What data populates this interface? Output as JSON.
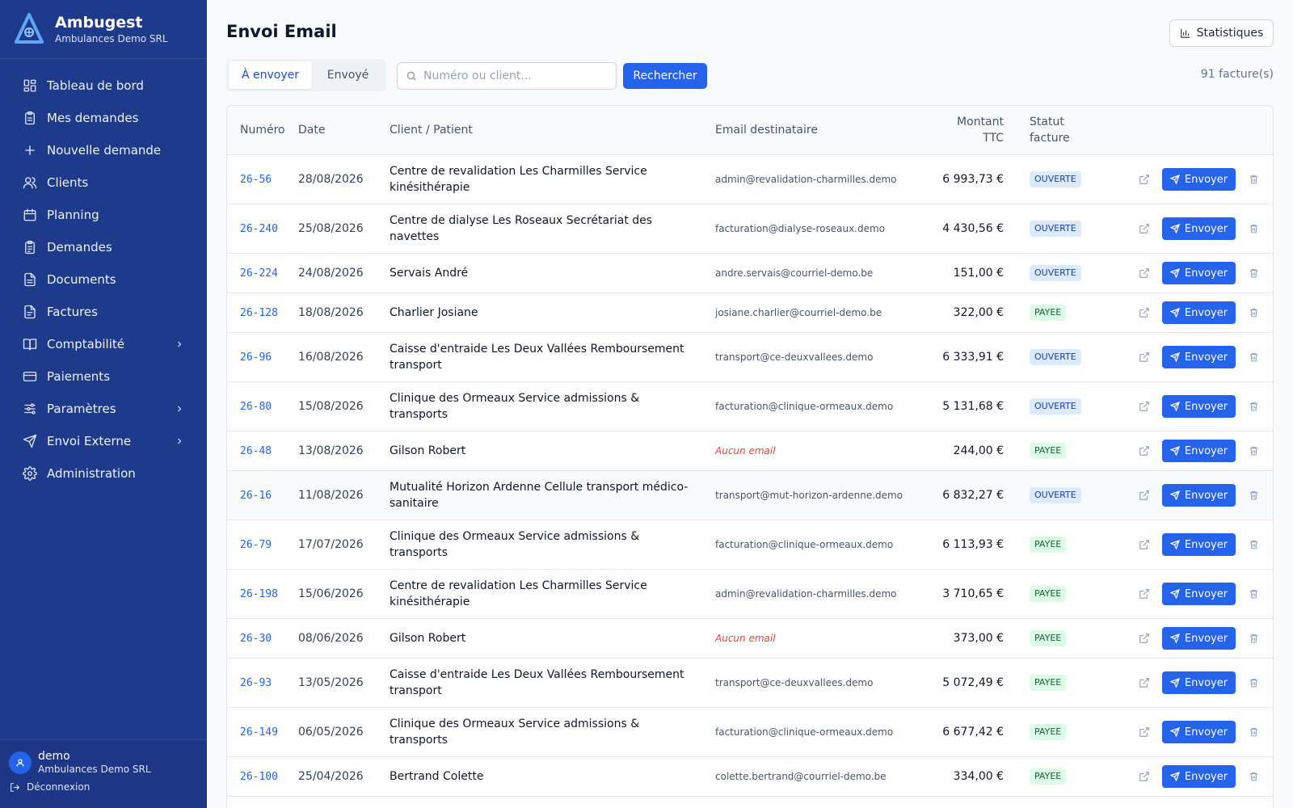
{
  "brand": {
    "name": "Ambugest",
    "subtitle": "Ambulances Demo SRL"
  },
  "nav": [
    {
      "label": "Tableau de bord",
      "icon": "dashboard-icon",
      "chevron": false
    },
    {
      "label": "Mes demandes",
      "icon": "clipboard-icon",
      "chevron": false
    },
    {
      "label": "Nouvelle demande",
      "icon": "plus-icon",
      "chevron": false
    },
    {
      "label": "Clients",
      "icon": "users-icon",
      "chevron": false
    },
    {
      "label": "Planning",
      "icon": "calendar-icon",
      "chevron": false
    },
    {
      "label": "Demandes",
      "icon": "clipboard-list-icon",
      "chevron": false
    },
    {
      "label": "Documents",
      "icon": "document-icon",
      "chevron": false
    },
    {
      "label": "Factures",
      "icon": "invoice-icon",
      "chevron": false
    },
    {
      "label": "Comptabilité",
      "icon": "book-icon",
      "chevron": true
    },
    {
      "label": "Paiements",
      "icon": "card-icon",
      "chevron": false
    },
    {
      "label": "Paramètres",
      "icon": "sliders-icon",
      "chevron": true
    },
    {
      "label": "Envoi Externe",
      "icon": "send-icon",
      "chevron": true
    },
    {
      "label": "Administration",
      "icon": "gear-icon",
      "chevron": false
    }
  ],
  "user": {
    "name": "demo",
    "org": "Ambulances Demo SRL",
    "logout": "Déconnexion"
  },
  "page": {
    "title": "Envoi Email",
    "stats_label": "Statistiques"
  },
  "tabs": {
    "active": "À envoyer",
    "inactive": "Envoyé"
  },
  "search": {
    "placeholder": "Numéro ou client...",
    "value": "",
    "button": "Rechercher"
  },
  "count": "91 facture(s)",
  "columns": {
    "num": "Numéro",
    "date": "Date",
    "client": "Client / Patient",
    "email": "Email destinataire",
    "amount": "Montant TTC",
    "status": "Statut facture"
  },
  "send_label": "Envoyer",
  "colors": {
    "sidebar": "#1e3a8a",
    "accent": "#2563eb",
    "badge_open": "#dbeafe",
    "badge_paid": "#dcfce7",
    "no_email": "#ef4444"
  },
  "rows": [
    {
      "num": "26-56",
      "date": "28/08/2026",
      "client": "Centre de revalidation Les Charmilles Service kinésithérapie",
      "email": "admin@revalidation-charmilles.demo",
      "amount": "6 993,73 €",
      "status": "OUVERTE"
    },
    {
      "num": "26-240",
      "date": "25/08/2026",
      "client": "Centre de dialyse Les Roseaux Secrétariat des navettes",
      "email": "facturation@dialyse-roseaux.demo",
      "amount": "4 430,56 €",
      "status": "OUVERTE"
    },
    {
      "num": "26-224",
      "date": "24/08/2026",
      "client": "Servais André",
      "email": "andre.servais@courriel-demo.be",
      "amount": "151,00 €",
      "status": "OUVERTE"
    },
    {
      "num": "26-128",
      "date": "18/08/2026",
      "client": "Charlier Josiane",
      "email": "josiane.charlier@courriel-demo.be",
      "amount": "322,00 €",
      "status": "PAYEE"
    },
    {
      "num": "26-96",
      "date": "16/08/2026",
      "client": "Caisse d'entraide Les Deux Vallées Remboursement transport",
      "email": "transport@ce-deuxvallees.demo",
      "amount": "6 333,91 €",
      "status": "OUVERTE"
    },
    {
      "num": "26-80",
      "date": "15/08/2026",
      "client": "Clinique des Ormeaux Service admissions & transports",
      "email": "facturation@clinique-ormeaux.demo",
      "amount": "5 131,68 €",
      "status": "OUVERTE"
    },
    {
      "num": "26-48",
      "date": "13/08/2026",
      "client": "Gilson Robert",
      "email": "Aucun email",
      "amount": "244,00 €",
      "status": "PAYEE"
    },
    {
      "num": "26-16",
      "date": "11/08/2026",
      "client": "Mutualité Horizon Ardenne Cellule transport médico-sanitaire",
      "email": "transport@mut-horizon-ardenne.demo",
      "amount": "6 832,27 €",
      "status": "OUVERTE"
    },
    {
      "num": "26-79",
      "date": "17/07/2026",
      "client": "Clinique des Ormeaux Service admissions & transports",
      "email": "facturation@clinique-ormeaux.demo",
      "amount": "6 113,93 €",
      "status": "PAYEE"
    },
    {
      "num": "26-198",
      "date": "15/06/2026",
      "client": "Centre de revalidation Les Charmilles Service kinésithérapie",
      "email": "admin@revalidation-charmilles.demo",
      "amount": "3 710,65 €",
      "status": "PAYEE"
    },
    {
      "num": "26-30",
      "date": "08/06/2026",
      "client": "Gilson Robert",
      "email": "Aucun email",
      "amount": "373,00 €",
      "status": "PAYEE"
    },
    {
      "num": "26-93",
      "date": "13/05/2026",
      "client": "Caisse d'entraide Les Deux Vallées Remboursement transport",
      "email": "transport@ce-deuxvallees.demo",
      "amount": "5 072,49 €",
      "status": "PAYEE"
    },
    {
      "num": "26-149",
      "date": "06/05/2026",
      "client": "Clinique des Ormeaux Service admissions & transports",
      "email": "facturation@clinique-ormeaux.demo",
      "amount": "6 677,42 €",
      "status": "PAYEE"
    },
    {
      "num": "26-100",
      "date": "25/04/2026",
      "client": "Bertrand Colette",
      "email": "colette.bertrand@courriel-demo.be",
      "amount": "334,00 €",
      "status": "PAYEE"
    }
  ]
}
